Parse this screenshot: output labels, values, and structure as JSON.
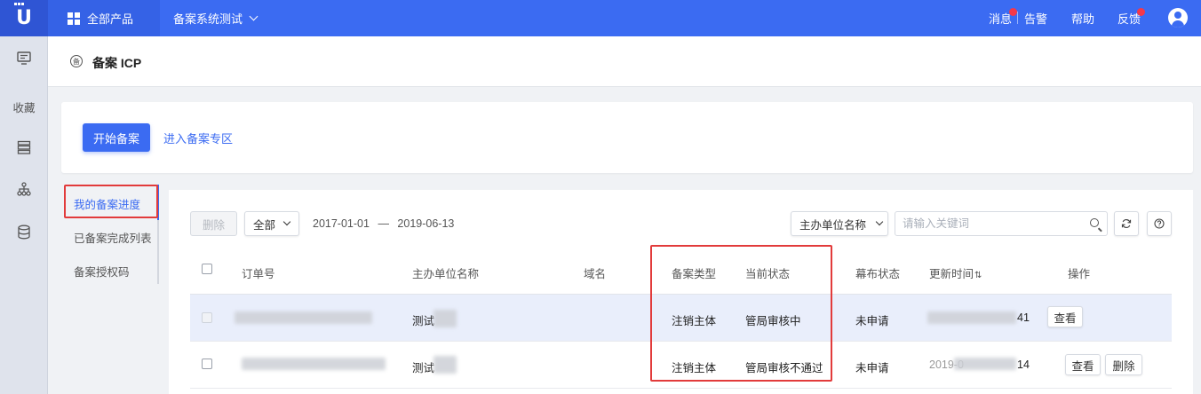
{
  "topbar": {
    "logo_letter": "U",
    "all_products": "全部产品",
    "project": "备案系统测试",
    "links": {
      "messages": "消息",
      "alerts": "告警",
      "help": "帮助",
      "feedback": "反馈"
    }
  },
  "rail": {
    "favorites": "收藏"
  },
  "page": {
    "title": "备案 ICP",
    "title_icon": "备"
  },
  "actions": {
    "start": "开始备案",
    "enter_zone": "进入备案专区"
  },
  "side_tabs": [
    "我的备案进度",
    "已备案完成列表",
    "备案授权码"
  ],
  "toolbar": {
    "delete": "删除",
    "filter": "全部",
    "date_from": "2017-01-01",
    "date_sep": "—",
    "date_to": "2019-06-13",
    "field_select": "主办单位名称",
    "search_placeholder": "请输入关键词"
  },
  "table": {
    "headers": {
      "order": "订单号",
      "org": "主办单位名称",
      "domain": "域名",
      "type": "备案类型",
      "status": "当前状态",
      "curtain": "幕布状态",
      "updated": "更新时间",
      "ops": "操作"
    },
    "rows": [
      {
        "org": "测试",
        "type": "注销主体",
        "status": "管局审核中",
        "curtain": "未申请",
        "time_tail": "41",
        "time_head": "",
        "ops": [
          "查看"
        ]
      },
      {
        "org": "测试",
        "type": "注销主体",
        "status": "管局审核不通过",
        "curtain": "未申请",
        "time_tail": "14",
        "time_head": "2019-0",
        "ops": [
          "查看",
          "删除"
        ]
      }
    ]
  },
  "colors": {
    "accent": "#3b6bf2",
    "highlight_box": "#e23b3b",
    "row_highlight": "#e9eefb"
  }
}
